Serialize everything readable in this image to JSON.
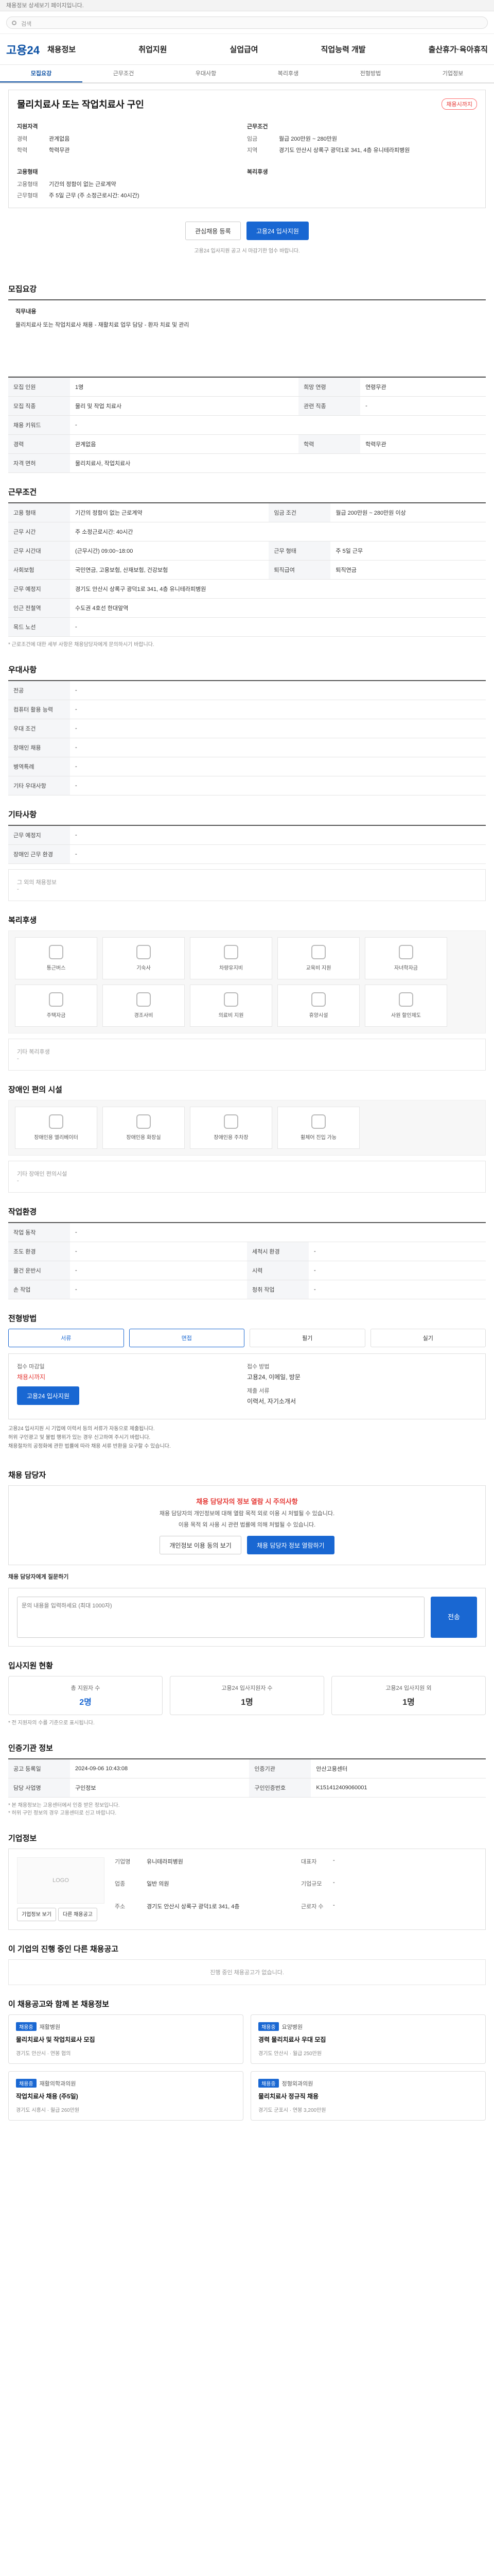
{
  "topbar": {
    "notice": "채용정보 상세보기 페이지입니다."
  },
  "urlbar": {
    "url": "검색"
  },
  "gnb": {
    "logo": "고용24",
    "menu": [
      "채용정보",
      "취업지원",
      "실업급여",
      "직업능력 개발",
      "출산휴가·육아휴직"
    ]
  },
  "tabs": [
    "모집요강",
    "근무조건",
    "우대사항",
    "복리후생",
    "전형방법",
    "기업정보"
  ],
  "job": {
    "title": "물리치료사 또는 작업치료사 구인",
    "badge": "채용시까지",
    "recruit_label": "지원자격",
    "career_k": "경력",
    "career_v": "관계없음",
    "edu_k": "학력",
    "edu_v": "학력무관",
    "cond_label": "근무조건",
    "wage_k": "임금",
    "wage_v": "월급 200만원 ~ 280만원",
    "region_k": "지역",
    "region_v": "경기도 안산시 상록구 광덕1로 341, 4층 유니테라피병원",
    "worktype_label": "고용형태",
    "emp_k": "고용형태",
    "emp_v": "기간의 정함이 없는 근로계약",
    "hours_k": "근무형태",
    "hours_v": "주 5일 근무 (주 소정근로시간: 40시간)",
    "benefit_label": "복리후생"
  },
  "actions": {
    "fav": "관심채용 등록",
    "apply": "고용24 입사지원",
    "note": "고용24 입사지원 공고 시 마감기한 엄수 바랍니다."
  },
  "recruit": {
    "title": "모집요강",
    "job_content_label": "직무내용",
    "job_content": "물리치료사 또는 작업치료사 채용 - 재활치료 업무 담당 - 환자 치료 및 관리",
    "rows": [
      {
        "k": "모집 인원",
        "v": "1명",
        "k2": "희망 연령",
        "v2": "연령무관"
      },
      {
        "k": "모집 직종",
        "v": "물리 및 작업 치료사",
        "k2": "관련 직종",
        "v2": "-"
      },
      {
        "k": "채용 키워드",
        "v": "-",
        "k2": "",
        "v2": ""
      },
      {
        "k": "경력",
        "v": "관계없음",
        "k2": "학력",
        "v2": "학력무관"
      },
      {
        "k": "자격 면허",
        "v": "물리치료사, 작업치료사",
        "k2": "",
        "v2": ""
      }
    ]
  },
  "work": {
    "title": "근무조건",
    "rows": [
      {
        "k": "고용 형태",
        "v": "기간의 정함이 없는 근로계약",
        "k2": "임금 조건",
        "v2": "월급 200만원 ~ 280만원 이상"
      },
      {
        "k": "근무 시간",
        "v": "주 소정근로시간: 40시간",
        "k2": "",
        "v2": ""
      },
      {
        "k": "근무 시간대",
        "v": "(근무시간) 09:00~18:00",
        "k2": "근무 형태",
        "v2": "주 5일 근무"
      },
      {
        "k": "사회보험",
        "v": "국민연금, 고용보험, 산재보험, 건강보험",
        "k2": "퇴직급여",
        "v2": "퇴직연금"
      },
      {
        "k": "근무 예정지",
        "v": "경기도 안산시 상록구 광덕1로 341, 4층 유니테라피병원",
        "k2": "",
        "v2": ""
      },
      {
        "k": "인근 전철역",
        "v": "수도권 4호선 한대앞역",
        "k2": "",
        "v2": ""
      },
      {
        "k": "목드 노선",
        "v": "-",
        "k2": "",
        "v2": ""
      }
    ],
    "note": "* 근로조건에 대한 세부 사항은 채용담당자에게 문의하시기 바랍니다."
  },
  "pref": {
    "title": "우대사항",
    "rows": [
      {
        "k": "전공",
        "v": "-"
      },
      {
        "k": "컴퓨터 활용 능력",
        "v": "-"
      },
      {
        "k": "우대 조건",
        "v": "-"
      },
      {
        "k": "장애인 채용",
        "v": "-"
      },
      {
        "k": "병역특례",
        "v": "-"
      },
      {
        "k": "기타 우대사항",
        "v": "-"
      }
    ]
  },
  "etc": {
    "title": "기타사항",
    "rows": [
      {
        "k": "근무 예정지",
        "v": "-"
      },
      {
        "k": "장애인 근무 환경",
        "v": "-"
      }
    ],
    "other_label": "그 외의 채용정보",
    "other_v": "-"
  },
  "welfare": {
    "title": "복리후생",
    "items": [
      "통근버스",
      "기숙사",
      "차량유지비",
      "교육비 지원",
      "자녀학자금",
      "주택자금",
      "경조사비",
      "의료비 지원",
      "휴양시설",
      "사원 할인제도"
    ],
    "other_label": "기타 복리후생",
    "other_v": "-"
  },
  "disability": {
    "title": "장애인 편의 시설",
    "items": [
      "장애인용 엘리베이터",
      "장애인용 화장실",
      "장애인용 주차장",
      "휠체어 진입 가능"
    ],
    "other_label": "기타 장애인 편의시설",
    "other_v": "-"
  },
  "workenv": {
    "title": "작업환경",
    "rows": [
      {
        "k": "작업 동작",
        "v": "-",
        "k2": "",
        "v2": ""
      },
      {
        "k": "조도 환경",
        "v": "-",
        "k2": "세척시 환경",
        "v2": "-"
      },
      {
        "k": "물건 운반시",
        "v": "-",
        "k2": "시력",
        "v2": "-"
      },
      {
        "k": "손 작업",
        "v": "-",
        "k2": "청취 작업",
        "v2": "-"
      }
    ]
  },
  "process": {
    "title": "전형방법",
    "methods": [
      "서류",
      "면접",
      "필기",
      "실기"
    ],
    "deadline_k": "접수 마감일",
    "deadline_v": "채용시까지",
    "method_k": "접수 방법",
    "method_v": "고용24, 이메일, 방문",
    "docs_k": "제출 서류",
    "docs_v": "이력서, 자기소개서",
    "apply_btn": "고용24 입사지원",
    "bullets": [
      "고용24 입사지원 시 기업에 이력서 등의 서류가 자동으로 제출됩니다.",
      "허위 구인광고 및 불법 행위가 있는 경우 신고하여 주시기 바랍니다.",
      "채용절차의 공정화에 관한 법률에 따라 채용 서류 반환을 요구할 수 있습니다."
    ]
  },
  "contact": {
    "title": "채용 담당자",
    "alert": "채용 담당자의 정보 열람 시 주의사항",
    "msg1": "채용 담당자의 개인정보에 대해 열람 목적 외로 이용 시 처벌될 수 있습니다.",
    "msg2": "이용 목적 외 사용 시 관련 법률에 의해 처벌될 수 있습니다.",
    "btn1": "개인정보 이용 동의 보기",
    "btn2": "채용 담당자 정보 열람하기",
    "chat_label": "채용 담당자에게 질문하기",
    "placeholder": "문의 내용을 입력하세요 (최대 1000자)",
    "send": "전송"
  },
  "applicants": {
    "title": "입사지원 현황",
    "items": [
      {
        "k": "총 지원자 수",
        "v": "2명"
      },
      {
        "k": "고용24 입사지원자 수",
        "v": "1명"
      },
      {
        "k": "고용24 입사지원 외",
        "v": "1명"
      }
    ],
    "note": "* 전 지원자의 수를 기준으로 표시됩니다."
  },
  "info": {
    "title": "인증기관 정보",
    "rows": [
      {
        "k": "공고 등록일",
        "v": "2024-09-06 10:43:08",
        "k2": "인증기관",
        "v2": "안산고용센터"
      },
      {
        "k": "담당 사업명",
        "v": "구인정보",
        "k2": "구인인증번호",
        "v2": "K151412409060001"
      }
    ],
    "notes": [
      "* 본 채용정보는 고용센터에서 인증 받은 정보입니다.",
      "* 허위 구인 정보의 경우 고용센터로 신고 바랍니다."
    ]
  },
  "company": {
    "title": "기업정보",
    "logo": "LOGO",
    "name_k": "기업명",
    "name_v": "유니테라피병원",
    "ceo_k": "대표자",
    "ceo_v": "-",
    "industry_k": "업종",
    "industry_v": "일반 의원",
    "size_k": "기업규모",
    "size_v": "-",
    "address_k": "주소",
    "address_v": "경기도 안산시 상록구 광덕1로 341, 4층",
    "emp_k": "근로자 수",
    "emp_v": "-",
    "btn1": "기업정보 보기",
    "btn2": "다른 채용공고"
  },
  "others": {
    "title": "이 기업의 진행 중인 다른 채용공고",
    "empty": "진행 중인 채용공고가 없습니다."
  },
  "recommend": {
    "title": "이 채용공고와 함께 본 채용정보",
    "cards": [
      {
        "badge": "채용중",
        "co": "재활병원",
        "title": "물리치료사 및 작업치료사 모집",
        "meta": "경기도 안산시 · 연봉 협의"
      },
      {
        "badge": "채용중",
        "co": "요양병원",
        "title": "경력 물리치료사 우대 모집",
        "meta": "경기도 안산시 · 월급 250만원"
      },
      {
        "badge": "채용중",
        "co": "재활의학과의원",
        "title": "작업치료사 채용 (주5일)",
        "meta": "경기도 시흥시 · 월급 260만원"
      },
      {
        "badge": "채용중",
        "co": "정형외과의원",
        "title": "물리치료사 정규직 채용",
        "meta": "경기도 군포시 · 연봉 3,200만원"
      }
    ]
  }
}
